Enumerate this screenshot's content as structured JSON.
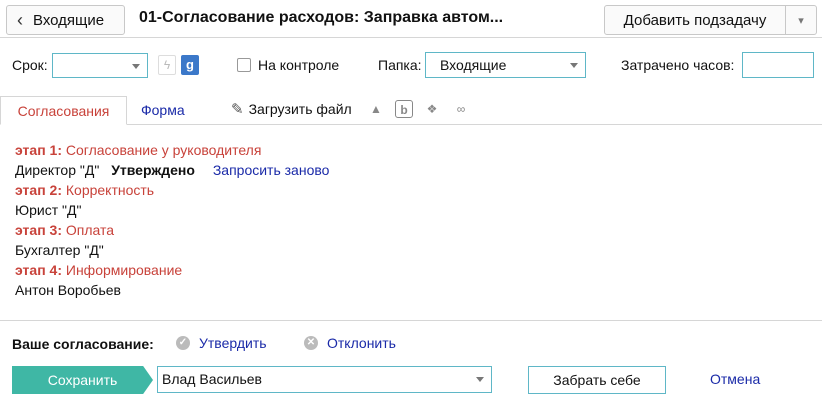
{
  "header": {
    "back_label": "Входящие",
    "task_title": "01-Согласование расходов: Заправка автом...",
    "add_subtask_label": "Добавить подзадачу"
  },
  "fields": {
    "due_label": "Срок:",
    "due_value": "",
    "control_label": "На контроле",
    "folder_label": "Папка:",
    "folder_value": "Входящие",
    "hours_label": "Затрачено часов:",
    "hours_value": ""
  },
  "tabs": {
    "approvals": "Согласования",
    "form": "Форма",
    "upload": "Загрузить файл"
  },
  "stages": [
    {
      "num": "этап 1:",
      "name": "Согласование у руководителя",
      "approver": "Директор \"Д\"",
      "status": "Утверждено",
      "action": "Запросить заново"
    },
    {
      "num": "этап 2:",
      "name": "Корректность",
      "approver": "Юрист \"Д\""
    },
    {
      "num": "этап 3:",
      "name": "Оплата",
      "approver": "Бухгалтер \"Д\""
    },
    {
      "num": "этап 4:",
      "name": "Информирование",
      "approver": "Антон Воробьев"
    }
  ],
  "approval": {
    "label": "Ваше согласование:",
    "approve": "Утвердить",
    "reject": "Отклонить"
  },
  "footer": {
    "save": "Сохранить",
    "assignee": "Влад Васильев",
    "take": "Забрать себе",
    "cancel": "Отмена"
  },
  "colors": {
    "accent": "#3fb7a5",
    "link": "#1a2aa8",
    "stage": "#c8423a",
    "input_border": "#5fb7c7"
  },
  "icons": [
    "chevron-left-icon",
    "chevron-down-icon",
    "flash-icon",
    "google-icon",
    "paperclip-icon",
    "google-drive-icon",
    "box-icon",
    "dropbox-icon",
    "link-icon",
    "check-circle-icon",
    "x-circle-icon"
  ]
}
